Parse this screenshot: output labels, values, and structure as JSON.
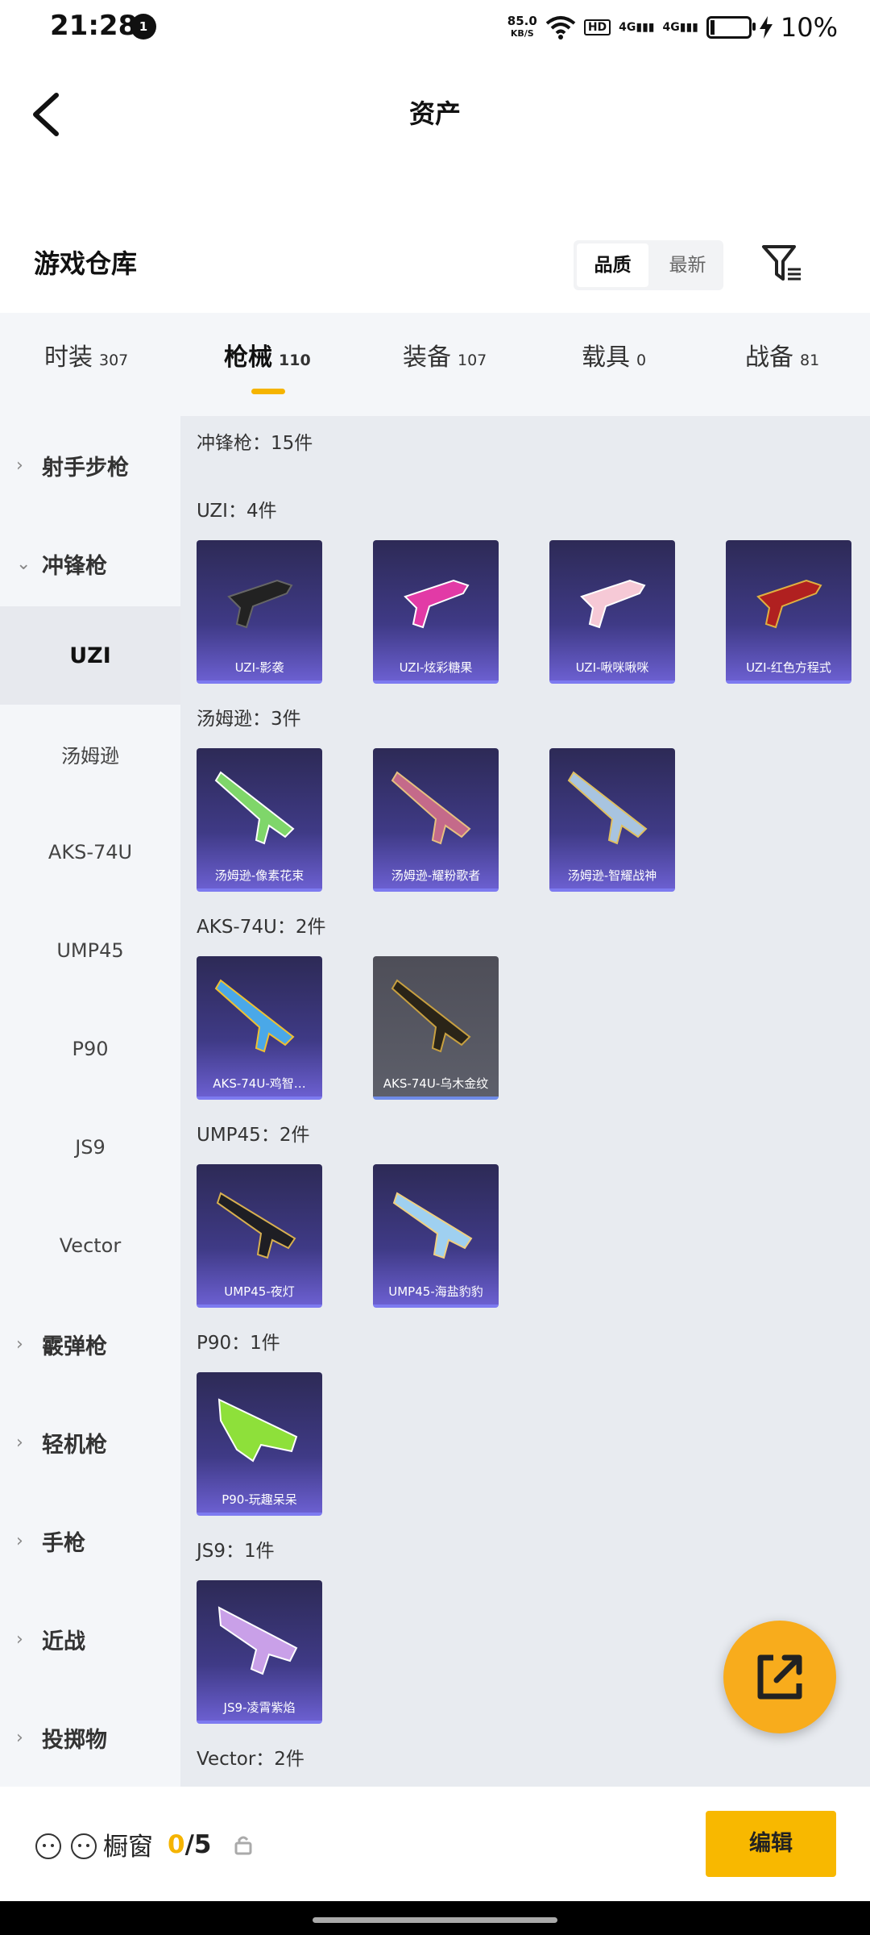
{
  "status_bar": {
    "time": "21:28",
    "notification_count": "1",
    "net_speed": "85.0",
    "net_unit": "KB/S",
    "hd": "HD",
    "sig1": "4G",
    "sig2": "4G",
    "battery": "10%"
  },
  "header": {
    "title": "资产"
  },
  "warehouse": {
    "title": "游戏仓库",
    "sort_options": [
      "品质",
      "最新"
    ]
  },
  "tabs": [
    {
      "label": "时装",
      "count": "307"
    },
    {
      "label": "枪械",
      "count": "110"
    },
    {
      "label": "装备",
      "count": "107"
    },
    {
      "label": "载具",
      "count": "0"
    },
    {
      "label": "战备",
      "count": "81"
    }
  ],
  "sidebar": [
    {
      "label": "射手步枪",
      "arrow": "›"
    },
    {
      "label": "冲锋枪",
      "arrow": "⌄"
    },
    {
      "label": "UZI"
    },
    {
      "label": "汤姆逊"
    },
    {
      "label": "AKS-74U"
    },
    {
      "label": "UMP45"
    },
    {
      "label": "P90"
    },
    {
      "label": "JS9"
    },
    {
      "label": "Vector"
    },
    {
      "label": "霰弹枪",
      "arrow": "›"
    },
    {
      "label": "轻机枪",
      "arrow": "›"
    },
    {
      "label": "手枪",
      "arrow": "›"
    },
    {
      "label": "近战",
      "arrow": "›"
    },
    {
      "label": "投掷物",
      "arrow": "›"
    }
  ],
  "content": {
    "category_header": "冲锋枪：15件",
    "groups": [
      {
        "title": "UZI：4件",
        "items": [
          "UZI-影袭",
          "UZI-炫彩糖果",
          "UZI-啾咪啾咪",
          "UZI-红色方程式"
        ]
      },
      {
        "title": "汤姆逊：3件",
        "items": [
          "汤姆逊-像素花束",
          "汤姆逊-耀粉歌者",
          "汤姆逊-智耀战神"
        ]
      },
      {
        "title": "AKS-74U：2件",
        "items": [
          "AKS-74U-鸡智…",
          "AKS-74U-乌木金纹"
        ]
      },
      {
        "title": "UMP45：2件",
        "items": [
          "UMP45-夜灯",
          "UMP45-海盐豹豹"
        ]
      },
      {
        "title": "P90：1件",
        "items": [
          "P90-玩趣呆呆"
        ]
      },
      {
        "title": "JS9：1件",
        "items": [
          "JS9-凌霄紫焰"
        ]
      },
      {
        "title": "Vector：2件",
        "items": []
      }
    ]
  },
  "bottom": {
    "showcase_label": "橱窗",
    "showcase_current": "0",
    "showcase_total": "/5",
    "edit_label": "编辑"
  },
  "colors": {
    "accent": "#f8b800",
    "item_bg": "#3f3a86",
    "item_border": "#7d7af0"
  }
}
